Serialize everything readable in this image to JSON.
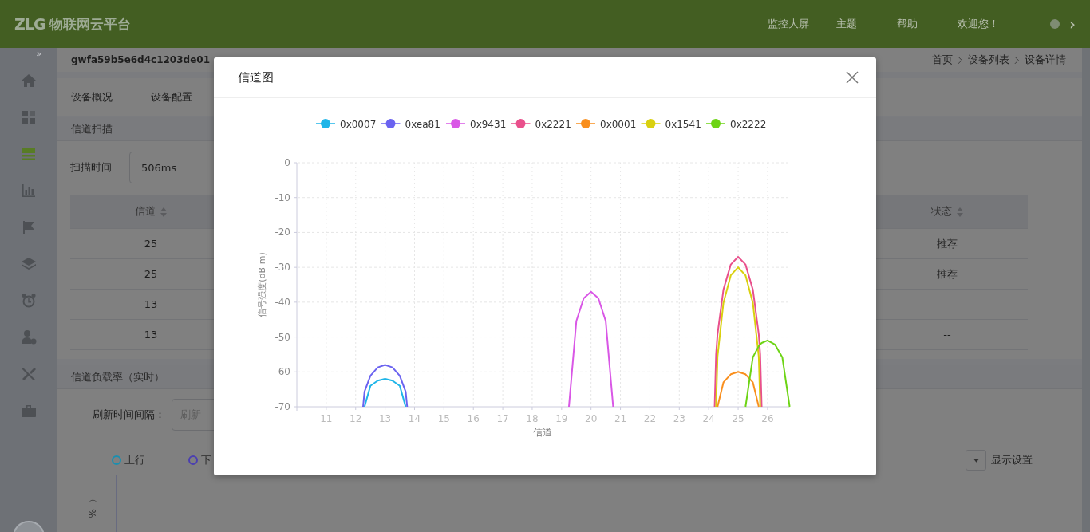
{
  "header": {
    "logo": "ZLG",
    "app_name": "物联网云平台",
    "nav": [
      {
        "label": "监控大屏"
      },
      {
        "label": "主题"
      },
      {
        "label": "帮助"
      },
      {
        "label": "欢迎您！"
      }
    ],
    "chevron": "›"
  },
  "sidebar": {
    "toggle": "»",
    "items": [
      {
        "kind": "home",
        "selected": false
      },
      {
        "kind": "dashboard",
        "selected": false
      },
      {
        "kind": "list",
        "selected": true
      },
      {
        "kind": "chart",
        "selected": false
      },
      {
        "kind": "flag",
        "selected": false
      },
      {
        "kind": "layers",
        "selected": false
      },
      {
        "kind": "alarm",
        "selected": false
      },
      {
        "kind": "user",
        "selected": false
      },
      {
        "kind": "tools",
        "selected": false
      },
      {
        "kind": "briefcase",
        "selected": false
      }
    ]
  },
  "page": {
    "title": "gwfa59b5e6d4c1203de01",
    "breadcrumb": [
      "首页",
      "设备列表",
      "设备详情"
    ],
    "tabs": [
      {
        "label": "设备概况"
      },
      {
        "label": "设备配置"
      }
    ]
  },
  "scan": {
    "title": "信道扫描",
    "time_label": "扫描时间",
    "time_value": "506ms",
    "columns": [
      "信道",
      "状态"
    ],
    "rows": [
      [
        "25",
        "推荐"
      ],
      [
        "25",
        "推荐"
      ],
      [
        "13",
        "--"
      ],
      [
        "13",
        "--"
      ]
    ]
  },
  "load": {
    "title": "信道负载率（实时）",
    "interval_label": "刷新时间间隔：",
    "interval_placeholder": "刷新",
    "legend": [
      {
        "label": "上行",
        "color": "#1a8fb0"
      },
      {
        "label": "下",
        "color": "#4b3fb0"
      }
    ],
    "display_settings": "显示设置",
    "ylabel": "%）"
  },
  "modal": {
    "title": "信道图",
    "chart_data": {
      "type": "line",
      "grid": true,
      "legend": true,
      "xlabel": "信道",
      "ylabel": "信号强度(dB m)",
      "x": [
        12.25,
        12.3,
        12.5,
        12.75,
        13,
        13.25,
        13.5,
        13.7,
        13.75,
        19.25,
        19.5,
        19.75,
        20,
        20.25,
        20.5,
        20.75,
        24.2,
        24.25,
        24.3,
        24.5,
        24.75,
        25,
        25.25,
        25.5,
        25.7,
        25.75,
        25.8,
        26,
        26.25,
        26.5,
        26.75
      ],
      "xlim": [
        10,
        26.75
      ],
      "xticks": [
        11,
        12,
        13,
        14,
        15,
        16,
        17,
        18,
        19,
        20,
        21,
        22,
        23,
        24,
        25,
        26
      ],
      "ylim": [
        -70,
        0
      ],
      "yticks": [
        0,
        -10,
        -20,
        -30,
        -40,
        -50,
        -60,
        -70
      ],
      "series": [
        {
          "name": "0x0007",
          "color": "#1fb5e8",
          "values": [
            null,
            -70,
            -64,
            -62.5,
            -62,
            -62.5,
            -64,
            -70,
            null,
            null,
            null,
            null,
            null,
            null,
            null,
            null,
            null,
            null,
            null,
            null,
            null,
            null,
            null,
            null,
            null,
            null,
            null,
            null,
            null,
            null,
            null
          ]
        },
        {
          "name": "0xea81",
          "color": "#6b63f0",
          "values": [
            -70,
            -65.7,
            -61.1,
            -58.7,
            -58,
            -58.7,
            -61.1,
            -65.7,
            -70,
            null,
            null,
            null,
            null,
            null,
            null,
            null,
            null,
            null,
            null,
            null,
            null,
            null,
            null,
            null,
            null,
            null,
            null,
            null,
            null,
            null,
            null
          ]
        },
        {
          "name": "0x9431",
          "color": "#d957e6",
          "values": [
            null,
            null,
            null,
            null,
            null,
            null,
            null,
            null,
            null,
            -70,
            -45.4,
            -38.9,
            -37,
            -38.9,
            -45.4,
            -70,
            null,
            null,
            null,
            null,
            null,
            null,
            null,
            null,
            null,
            null,
            null,
            null,
            null,
            null,
            null
          ]
        },
        {
          "name": "0x2221",
          "color": "#e9508c",
          "values": [
            null,
            null,
            null,
            null,
            null,
            null,
            null,
            null,
            null,
            null,
            null,
            null,
            null,
            null,
            null,
            null,
            -70,
            -55,
            -49.2,
            -36.4,
            -29.2,
            -27,
            -29.2,
            -36.4,
            -49.2,
            -55,
            -70,
            null,
            null,
            null,
            null
          ]
        },
        {
          "name": "0x0001",
          "color": "#f98f1e",
          "values": [
            null,
            null,
            null,
            null,
            null,
            null,
            null,
            null,
            null,
            null,
            null,
            null,
            null,
            null,
            null,
            null,
            null,
            null,
            -70,
            -63,
            -60.7,
            -60,
            -60.7,
            -63,
            -70,
            null,
            null,
            null,
            null,
            null,
            null
          ]
        },
        {
          "name": "0x1541",
          "color": "#d9d00f",
          "values": [
            null,
            null,
            null,
            null,
            null,
            null,
            null,
            null,
            null,
            null,
            null,
            null,
            null,
            null,
            null,
            null,
            null,
            -70,
            -55.6,
            -40.2,
            -32.3,
            -30,
            -32.3,
            -40.2,
            -55.6,
            -70,
            null,
            null,
            null,
            null,
            null
          ]
        },
        {
          "name": "0x2222",
          "color": "#6dd415",
          "values": [
            null,
            null,
            null,
            null,
            null,
            null,
            null,
            null,
            null,
            null,
            null,
            null,
            null,
            null,
            null,
            null,
            null,
            null,
            null,
            null,
            null,
            null,
            -70,
            -55.8,
            -52.6,
            -52.1,
            -51.7,
            -51,
            -52.1,
            -55.8,
            -70
          ]
        }
      ]
    }
  }
}
